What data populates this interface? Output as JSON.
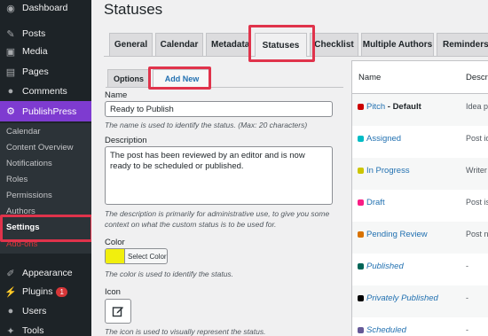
{
  "sidebar": {
    "items": [
      {
        "label": "Dashboard",
        "icon": "dashboard-icon",
        "glyph": "◉"
      },
      {
        "label": "Posts",
        "icon": "pin-icon",
        "glyph": "✎"
      },
      {
        "label": "Media",
        "icon": "media-icon",
        "glyph": "▣"
      },
      {
        "label": "Pages",
        "icon": "pages-icon",
        "glyph": "▤"
      },
      {
        "label": "Comments",
        "icon": "comments-icon",
        "glyph": "●"
      },
      {
        "label": "PublishPress",
        "icon": "publishpress-icon",
        "glyph": "⚙"
      },
      {
        "label": "Appearance",
        "icon": "appearance-icon",
        "glyph": "✐"
      },
      {
        "label": "Plugins",
        "icon": "plugins-icon",
        "glyph": "⚡",
        "badge": "1"
      },
      {
        "label": "Users",
        "icon": "users-icon",
        "glyph": "●"
      },
      {
        "label": "Tools",
        "icon": "tools-icon",
        "glyph": "✦"
      }
    ],
    "submenu": [
      "Calendar",
      "Content Overview",
      "Notifications",
      "Roles",
      "Permissions",
      "Authors",
      "Settings",
      "Add-ons"
    ]
  },
  "page": {
    "title": "Statuses"
  },
  "tabs": [
    "General",
    "Calendar",
    "Metadata",
    "Statuses",
    "Checklist",
    "Multiple Authors",
    "Reminders"
  ],
  "subtabs": [
    "Options",
    "Add New"
  ],
  "form": {
    "name_label": "Name",
    "name_value": "Ready to Publish",
    "name_help": "The name is used to identify the status. (Max: 20 characters)",
    "desc_label": "Description",
    "desc_value": "The post has been reviewed by an editor and is now ready to be scheduled or published.",
    "desc_help": "The description is primarily for administrative use, to give you some context on what the custom status is to be used for.",
    "color_label": "Color",
    "color_button": "Select Color",
    "color_value": "#f1ef0d",
    "color_help": "The color is used to identify the status.",
    "icon_label": "Icon",
    "icon_help": "The icon is used to visually represent the status."
  },
  "table": {
    "headers": [
      "Name",
      "Descrip"
    ],
    "rows": [
      {
        "name": "Pitch",
        "suffix": " - Default",
        "desc": "Idea pro",
        "color": "#cc0000",
        "italic": false
      },
      {
        "name": "Assigned",
        "suffix": "",
        "desc": "Post ide",
        "color": "#00bcc5",
        "italic": false
      },
      {
        "name": "In Progress",
        "suffix": "",
        "desc": "Writer is",
        "color": "#ccc500",
        "italic": false
      },
      {
        "name": "Draft",
        "suffix": "",
        "desc": "Post is a",
        "color": "#f91d84",
        "italic": false
      },
      {
        "name": "Pending Review",
        "suffix": "",
        "desc": "Post nee",
        "color": "#d87200",
        "italic": false
      },
      {
        "name": "Published",
        "suffix": "",
        "desc": "-",
        "color": "#006557",
        "italic": true
      },
      {
        "name": "Privately Published",
        "suffix": "",
        "desc": "-",
        "color": "#000000",
        "italic": true
      },
      {
        "name": "Scheduled",
        "suffix": "",
        "desc": "-",
        "color": "#655997",
        "italic": true
      }
    ]
  },
  "colors": {
    "accent": "#7e3bd0",
    "highlight": "#e0334b",
    "sidebar": "#1d2327"
  }
}
